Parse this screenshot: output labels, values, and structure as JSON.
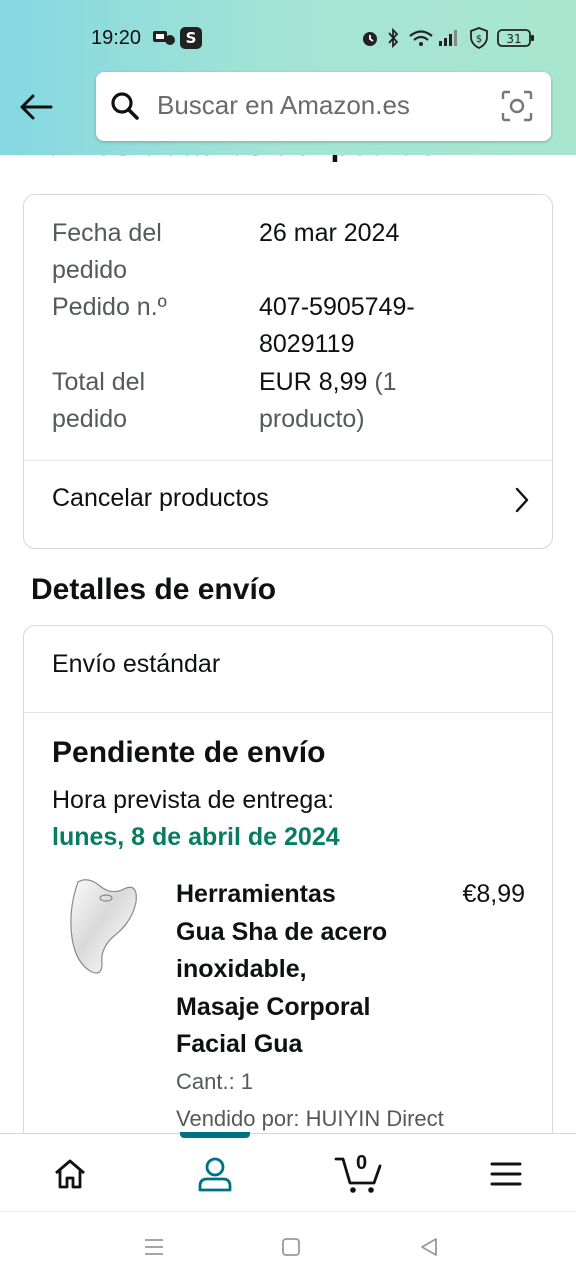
{
  "status_bar": {
    "time": "19:20",
    "battery": "31"
  },
  "search": {
    "placeholder": "Buscar en Amazon.es"
  },
  "page": {
    "title": "Ver los detalles del pedido"
  },
  "order_summary": {
    "date_label_1": "Fecha del",
    "date_label_2": "pedido",
    "date_value": "26 mar 2024",
    "number_label": "Pedido n.º",
    "number_value_1": "407-5905749-",
    "number_value_2": "8029119",
    "total_label_1": "Total del",
    "total_label_2": "pedido",
    "total_value_1": "EUR 8,99",
    "total_value_1b": "(1",
    "total_value_2": "producto)",
    "cancel_label": "Cancelar productos"
  },
  "shipping": {
    "section_title": "Detalles de envío",
    "type": "Envío estándar",
    "status": "Pendiente de envío",
    "eta_label": "Hora prevista de entrega:",
    "eta_date": "lunes, 8 de abril de 2024"
  },
  "product": {
    "name_lines": [
      "Herramientas",
      "Gua Sha de acero",
      "inoxidable,",
      "Masaje Corporal",
      "Facial Gua"
    ],
    "price": "€8,99",
    "qty": "Cant.: 1",
    "seller": "Vendido por: HUIYIN Direct"
  },
  "bottom_nav": {
    "cart_count": "0"
  },
  "colors": {
    "eta_green": "#067d62",
    "active_teal": "#007185",
    "header_gradient_start": "#84d8e2",
    "header_gradient_end": "#a8e6cf"
  }
}
